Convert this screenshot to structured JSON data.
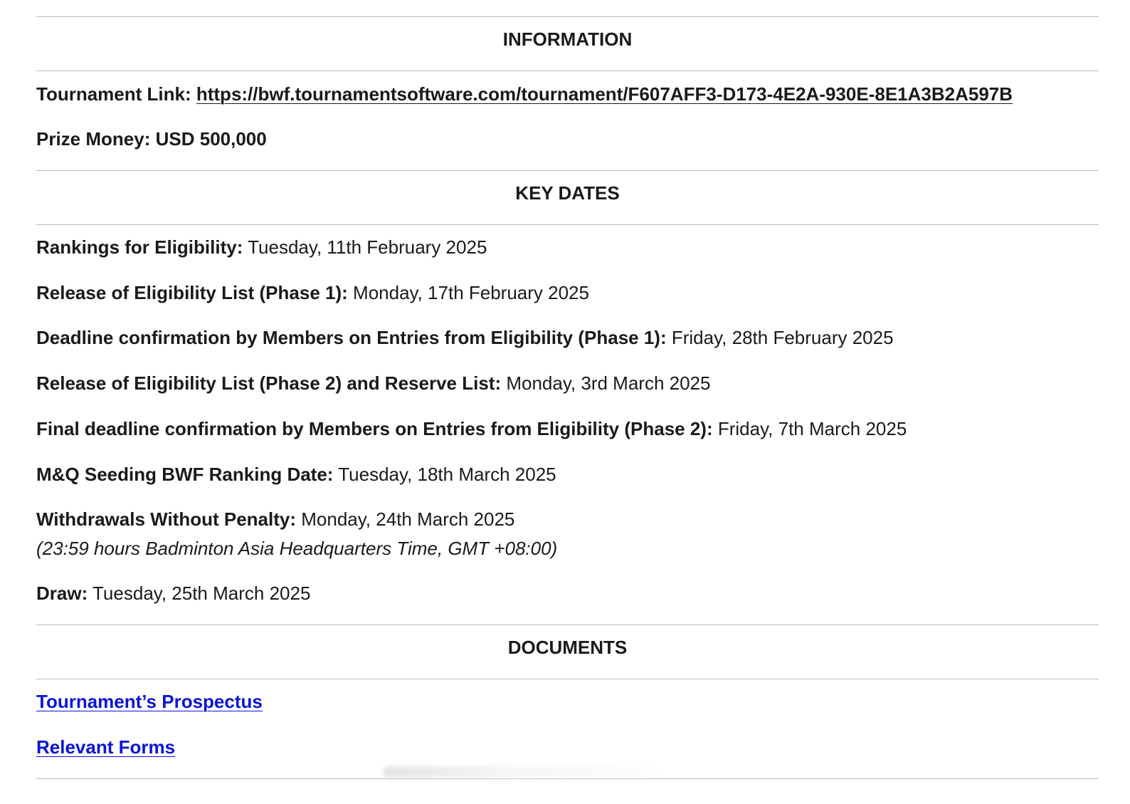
{
  "information": {
    "heading": "INFORMATION",
    "tournament_link_label": "Tournament Link:",
    "tournament_link_url": "https://bwf.tournamentsoftware.com/tournament/F607AFF3-D173-4E2A-930E-8E1A3B2A597B",
    "prize_money_label": "Prize Money:",
    "prize_money_value": "USD 500,000"
  },
  "key_dates": {
    "heading": "KEY DATES",
    "items": [
      {
        "label": "Rankings for Eligibility:",
        "value": "Tuesday, 11th February 2025"
      },
      {
        "label": "Release of Eligibility List (Phase 1):",
        "value": "Monday, 17th February 2025"
      },
      {
        "label": "Deadline confirmation by Members on Entries from Eligibility (Phase 1):",
        "value": "Friday, 28th February 2025"
      },
      {
        "label": "Release of Eligibility List (Phase 2) and Reserve List:",
        "value": "Monday, 3rd March 2025"
      },
      {
        "label": "Final deadline confirmation by Members on Entries from Eligibility (Phase 2):",
        "value": "Friday, 7th March 2025"
      },
      {
        "label": "M&Q Seeding BWF Ranking Date:",
        "value": "Tuesday, 18th March 2025"
      },
      {
        "label": "Withdrawals Without Penalty:",
        "value": "Monday, 24th March 2025"
      },
      {
        "label": "Draw:",
        "value": "Tuesday, 25th March 2025"
      }
    ],
    "withdrawal_note": "(23:59 hours Badminton Asia Headquarters Time, GMT +08:00)"
  },
  "documents": {
    "heading": "DOCUMENTS",
    "links": [
      {
        "label": "Tournament’s Prospectus"
      },
      {
        "label": "Relevant Forms"
      }
    ]
  },
  "colors": {
    "text": "#1a1a1a",
    "link": "#0a14d6",
    "rule": "#b9b9b9"
  }
}
